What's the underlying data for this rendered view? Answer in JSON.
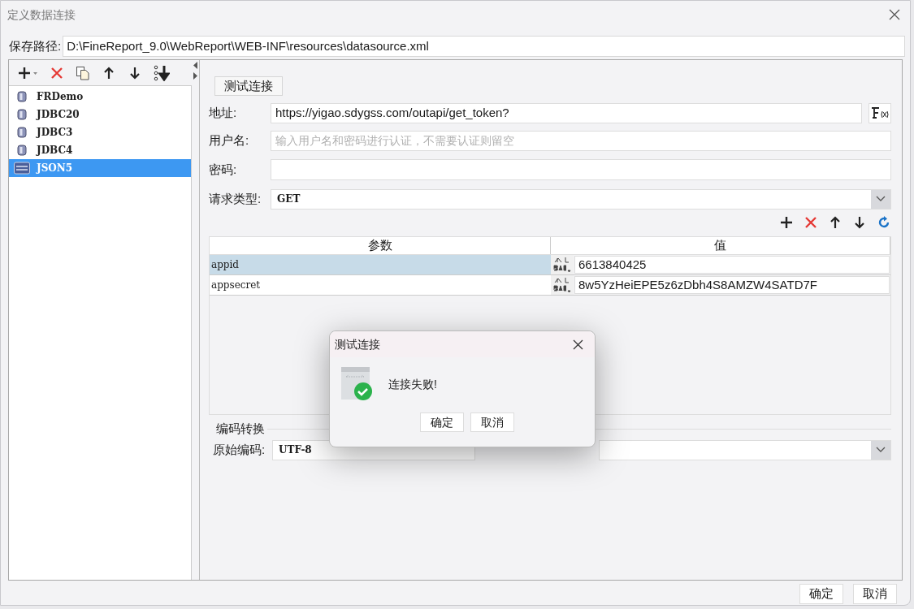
{
  "window": {
    "title": "定义数据连接"
  },
  "save_path": {
    "label": "保存路径:",
    "value": "D:\\FineReport_9.0\\WebReport\\WEB-INF\\resources\\datasource.xml"
  },
  "connections": [
    {
      "name": "FRDemo",
      "kind": "database",
      "selected": false
    },
    {
      "name": "JDBC20",
      "kind": "database",
      "selected": false
    },
    {
      "name": "JDBC3",
      "kind": "database",
      "selected": false
    },
    {
      "name": "JDBC4",
      "kind": "database",
      "selected": false
    },
    {
      "name": "JSON5",
      "kind": "json",
      "selected": true
    }
  ],
  "test_button": "测试连接",
  "form": {
    "address": {
      "label": "地址:",
      "value": "https://yigao.sdygss.com/outapi/get_token?"
    },
    "username": {
      "label": "用户名:",
      "placeholder": "输入用户名和密码进行认证，不需要认证则留空"
    },
    "password": {
      "label": "密码:"
    },
    "request_type": {
      "label": "请求类型:",
      "value": "GET"
    }
  },
  "params_table": {
    "columns": [
      "参数",
      "值"
    ],
    "rows": [
      {
        "name": "appid",
        "value": "6613840425",
        "selected": true
      },
      {
        "name": "appsecret",
        "value": "8w5YzHeiEPE5z6zDbh4S8AMZW4SATD7F",
        "selected": false
      }
    ]
  },
  "encoding": {
    "title": "编码转换",
    "source_label": "原始编码:",
    "source_value": "UTF-8"
  },
  "buttons": [
    "确定",
    "取消"
  ],
  "dialog": {
    "title": "测试连接",
    "message": "连接失败!",
    "buttons": [
      "确定",
      "取消"
    ]
  }
}
